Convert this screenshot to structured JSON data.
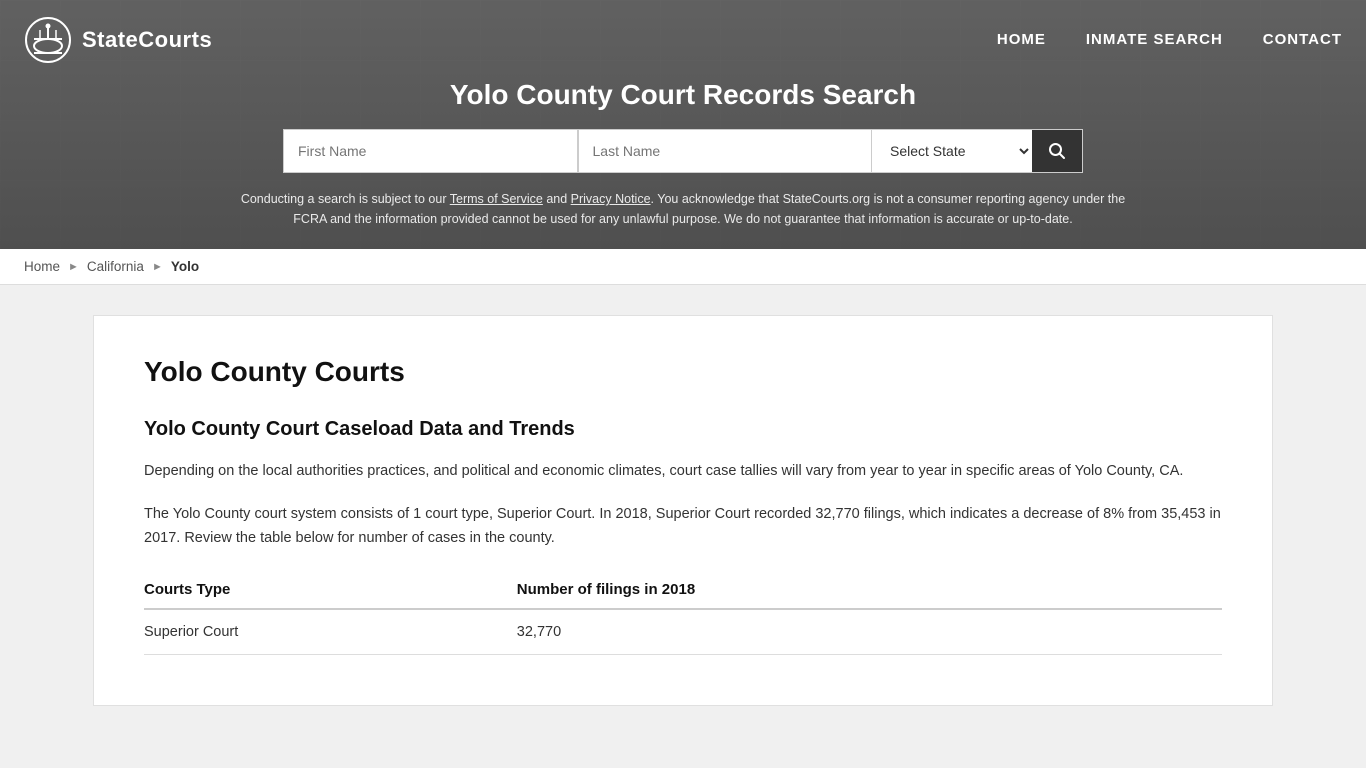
{
  "header": {
    "logo_text": "StateCourts",
    "page_title": "Yolo County Court Records Search",
    "nav": {
      "home_label": "HOME",
      "inmate_search_label": "INMATE SEARCH",
      "contact_label": "CONTACT"
    },
    "search": {
      "first_name_placeholder": "First Name",
      "last_name_placeholder": "Last Name",
      "select_state_label": "Select State",
      "search_icon": "🔍"
    },
    "disclaimer": {
      "text_before_tos": "Conducting a search is subject to our ",
      "tos_label": "Terms of Service",
      "text_between": " and ",
      "privacy_label": "Privacy Notice",
      "text_after": ". You acknowledge that StateCourts.org is not a consumer reporting agency under the FCRA and the information provided cannot be used for any unlawful purpose. We do not guarantee that information is accurate or up-to-date."
    }
  },
  "breadcrumb": {
    "home_label": "Home",
    "state_label": "California",
    "county_label": "Yolo"
  },
  "main": {
    "county_title": "Yolo County Courts",
    "section_title": "Yolo County Court Caseload Data and Trends",
    "paragraph1": "Depending on the local authorities practices, and political and economic climates, court case tallies will vary from year to year in specific areas of Yolo County, CA.",
    "paragraph2": "The Yolo County court system consists of 1 court type, Superior Court. In 2018, Superior Court recorded 32,770 filings, which indicates a decrease of 8% from 35,453 in 2017. Review the table below for number of cases in the county.",
    "table": {
      "col1_header": "Courts Type",
      "col2_header": "Number of filings in 2018",
      "rows": [
        {
          "court_type": "Superior Court",
          "filings": "32,770"
        }
      ]
    }
  }
}
